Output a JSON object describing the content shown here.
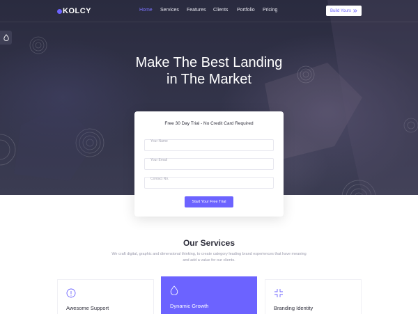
{
  "brand": {
    "logo_text": "KOLCY",
    "accent_color": "#6c63ff"
  },
  "nav": {
    "items": [
      {
        "label": "Home",
        "active": true
      },
      {
        "label": "Services",
        "active": false
      },
      {
        "label": "Features",
        "active": false
      },
      {
        "label": "Clients",
        "active": false
      },
      {
        "label": "Portfolio",
        "active": false
      },
      {
        "label": "Pricing",
        "active": false
      }
    ],
    "cta_label": "Build Yours",
    "cta_icon": "double-chevron-right-icon"
  },
  "side_tab": {
    "icon": "water-drop-icon"
  },
  "hero": {
    "title_line1": "Make The Best Landing",
    "title_line2": "in The Market"
  },
  "form": {
    "title": "Free 30 Day Trial - No Credit Card Required",
    "name_placeholder": "Your Name",
    "email_placeholder": "Your Email",
    "contact_placeholder": "Contact No.",
    "submit_label": "Start Your Free Trial"
  },
  "services": {
    "title": "Our Services",
    "description": "We craft digital, graphic and dimensional thinking, to create category leading brand experiences that have meaning and add a value for our clients.",
    "cards": [
      {
        "name": "Awesome Support",
        "icon": "info-circle-icon",
        "featured": false
      },
      {
        "name": "Dynamic Growth",
        "icon": "water-drop-icon",
        "featured": true
      },
      {
        "name": "Branding Identity",
        "icon": "expand-corners-icon",
        "featured": false
      }
    ]
  }
}
